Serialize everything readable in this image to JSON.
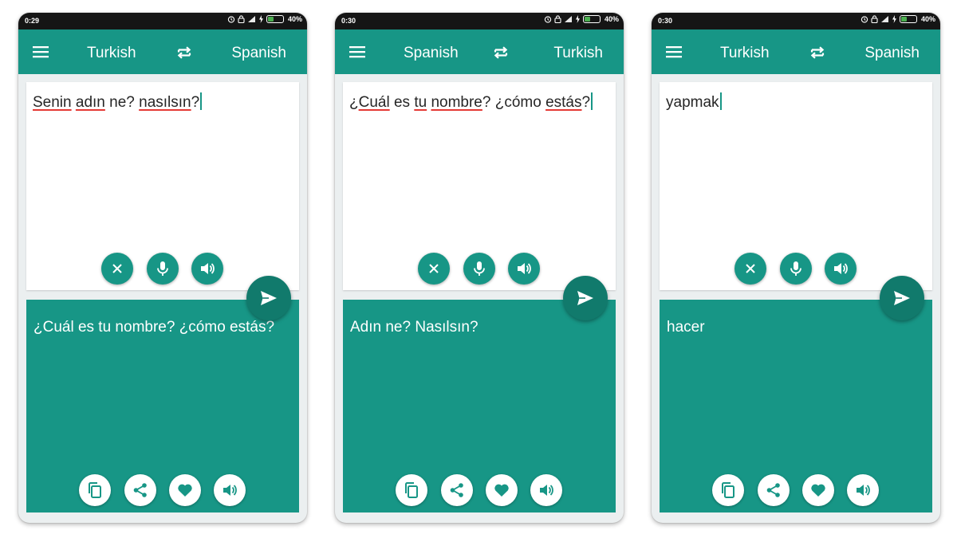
{
  "colors": {
    "primary": "#179686",
    "send": "#117a6c",
    "spell_underline": "#e53935"
  },
  "icons": [
    "menu-icon",
    "swap-icon",
    "close-icon",
    "mic-icon",
    "speaker-icon",
    "send-icon",
    "copy-icon",
    "share-icon",
    "heart-icon"
  ],
  "screens": [
    {
      "status_time": "0:29",
      "battery": "40%",
      "battery_level": 0.4,
      "source_lang": "Turkish",
      "target_lang": "Spanish",
      "input_words": [
        "Senin",
        " ",
        "adın",
        " ne? ",
        "nasılsın",
        "?"
      ],
      "output": "¿Cuál es tu nombre? ¿cómo estás?"
    },
    {
      "status_time": "0:30",
      "battery": "40%",
      "battery_level": 0.4,
      "source_lang": "Spanish",
      "target_lang": "Turkish",
      "input_words": [
        "¿",
        "Cuál",
        " es ",
        "tu",
        " ",
        "nombre",
        "? ¿cómo ",
        "estás",
        "?"
      ],
      "output": "Adın ne? Nasılsın?"
    },
    {
      "status_time": "0:30",
      "battery": "40%",
      "battery_level": 0.4,
      "source_lang": "Turkish",
      "target_lang": "Spanish",
      "input_words": [
        "yapmak"
      ],
      "output": "hacer"
    }
  ]
}
